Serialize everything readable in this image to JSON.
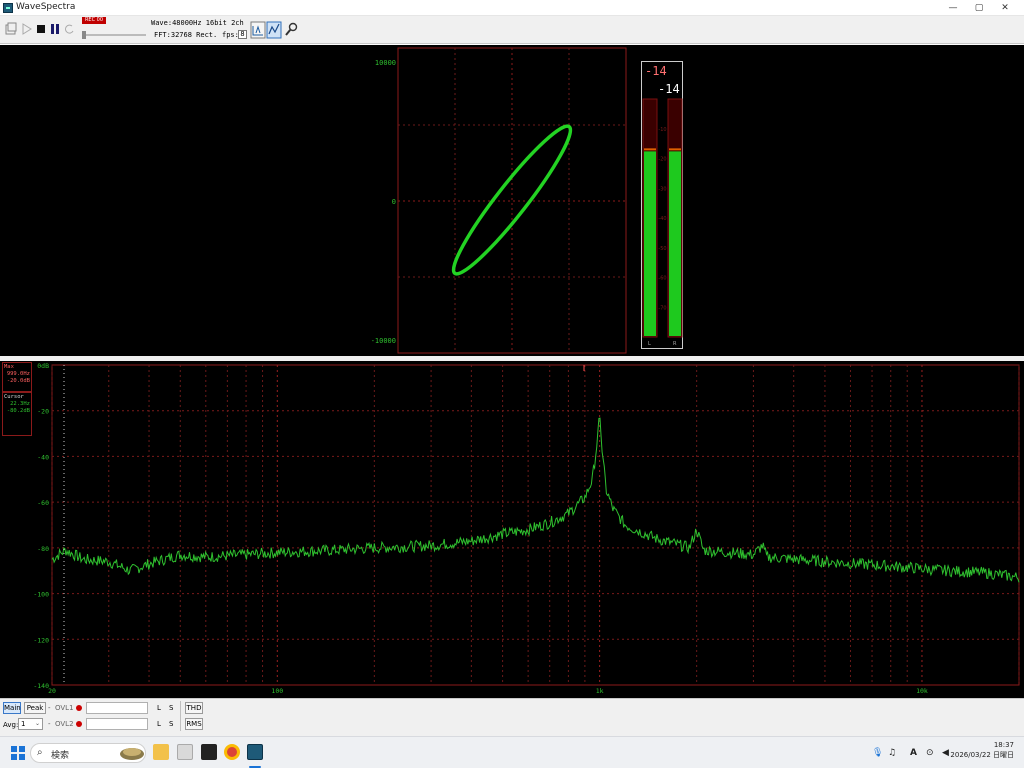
{
  "window": {
    "title": "WaveSpectra",
    "controls": [
      "—",
      "▢",
      "✕"
    ]
  },
  "toolbar": {
    "rec_label": "REC 00",
    "wave_info": "Wave:48000Hz 16bit 2ch",
    "fft_info": "FFT:32768 Rect.",
    "fps_label": "fps:",
    "fps_value": "8"
  },
  "lissajous": {
    "y_ticks": [
      "10000",
      "0",
      "-10000"
    ],
    "trace_color": "#23d323",
    "frame_color": "#8b1a1a"
  },
  "level_meter": {
    "left_peak": "-14",
    "right_peak": "-14",
    "left_level": 0.78,
    "right_level": 0.78,
    "scale": [
      "-10",
      "-20",
      "-30",
      "-40",
      "-50",
      "-60",
      "-70"
    ],
    "channel_labels": [
      "L",
      "R"
    ]
  },
  "spectrum": {
    "max_label": "Max",
    "max_freq": "999.0Hz",
    "max_db": "-20.0dB",
    "cursor_label": "Cursor",
    "cursor_freq": "22.3Hz",
    "cursor_db": "-80.2dB",
    "y_ticks": [
      "0dB",
      "-20",
      "-40",
      "-60",
      "-80",
      "-100",
      "-120",
      "-140"
    ],
    "x_ticks": [
      "20",
      "100",
      "1k",
      "10k"
    ],
    "trace_color": "#2fc02f"
  },
  "chart_data": {
    "type": "line",
    "title": "",
    "xlabel": "",
    "ylabel": "",
    "x_scale": "log",
    "xlim": [
      20,
      20000
    ],
    "ylim": [
      -140,
      0
    ],
    "grid": true,
    "series": [
      {
        "values": [
          [
            20,
            -85
          ],
          [
            22,
            -81
          ],
          [
            25,
            -85
          ],
          [
            30,
            -86
          ],
          [
            35,
            -90
          ],
          [
            40,
            -87
          ],
          [
            50,
            -83
          ],
          [
            60,
            -84
          ],
          [
            80,
            -83
          ],
          [
            100,
            -82
          ],
          [
            150,
            -81
          ],
          [
            200,
            -80
          ],
          [
            300,
            -79
          ],
          [
            400,
            -77
          ],
          [
            500,
            -74
          ],
          [
            600,
            -72
          ],
          [
            700,
            -69
          ],
          [
            800,
            -65
          ],
          [
            900,
            -58
          ],
          [
            950,
            -50
          ],
          [
            980,
            -35
          ],
          [
            999,
            -20
          ],
          [
            1020,
            -40
          ],
          [
            1050,
            -55
          ],
          [
            1100,
            -63
          ],
          [
            1200,
            -70
          ],
          [
            1500,
            -76
          ],
          [
            1900,
            -80
          ],
          [
            2000,
            -72
          ],
          [
            2100,
            -81
          ],
          [
            3000,
            -83
          ],
          [
            3200,
            -79
          ],
          [
            3300,
            -84
          ],
          [
            5000,
            -86
          ],
          [
            8000,
            -88
          ],
          [
            12000,
            -90
          ],
          [
            16000,
            -91
          ],
          [
            20000,
            -93
          ]
        ]
      }
    ]
  },
  "bottom": {
    "main_btn": "Main",
    "peak_btn": "Peak",
    "ovl1": "OVL1",
    "ovl2": "OVL2",
    "avg_label": "Avg:",
    "avg_value": "1",
    "l1": "L",
    "s1": "S",
    "l2": "L",
    "s2": "S",
    "thd_btn": "THD",
    "rms_btn": "RMS"
  },
  "taskbar": {
    "search_placeholder": "検索",
    "time": "18:37",
    "date": "2026/03/22 日曜日"
  }
}
